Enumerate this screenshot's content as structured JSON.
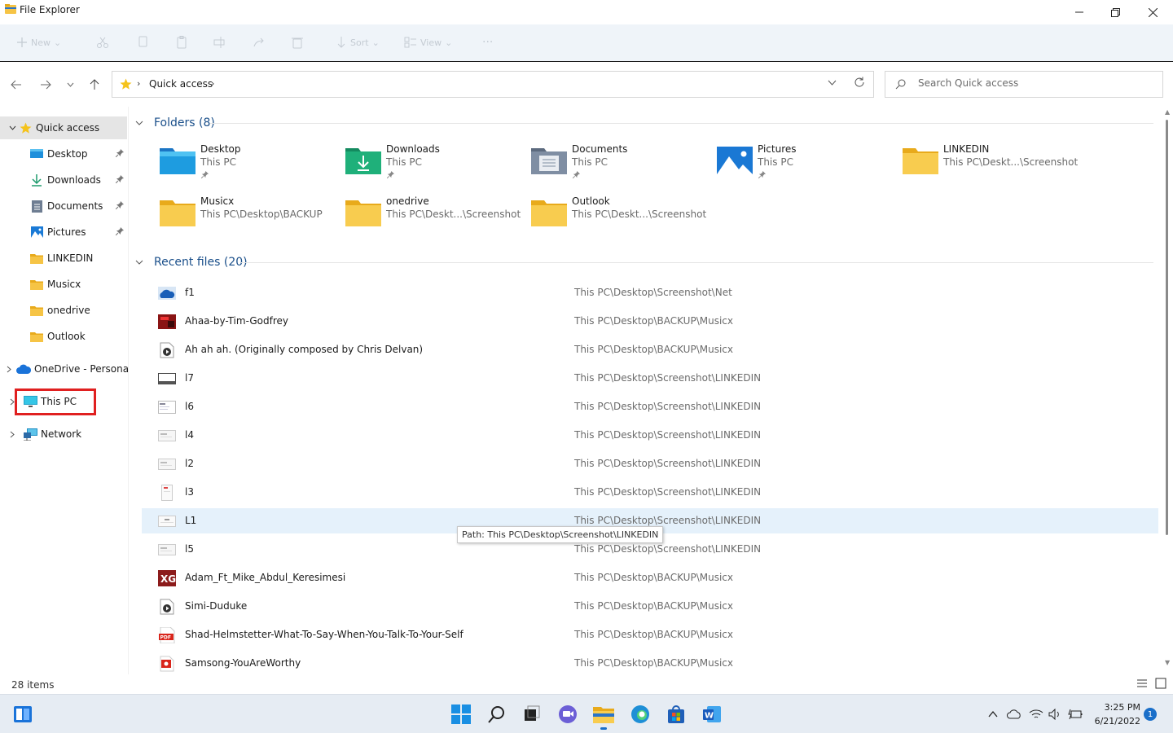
{
  "window": {
    "title": "File Explorer"
  },
  "toolbar": {
    "new_label": "New",
    "sort_label": "Sort",
    "view_label": "View",
    "more_label": "···"
  },
  "address": {
    "breadcrumb": "Quick access"
  },
  "search": {
    "placeholder": "Search Quick access"
  },
  "sidebar": {
    "items": [
      {
        "label": "Quick access",
        "icon": "star-icon"
      },
      {
        "label": "Desktop",
        "icon": "desktop-icon"
      },
      {
        "label": "Downloads",
        "icon": "download-icon"
      },
      {
        "label": "Documents",
        "icon": "document-icon"
      },
      {
        "label": "Pictures",
        "icon": "pictures-icon"
      },
      {
        "label": "LINKEDIN",
        "icon": "folder-icon"
      },
      {
        "label": "Musicx",
        "icon": "folder-icon"
      },
      {
        "label": "onedrive",
        "icon": "folder-icon"
      },
      {
        "label": "Outlook",
        "icon": "folder-icon"
      },
      {
        "label": "OneDrive - Personal",
        "icon": "cloud-icon"
      },
      {
        "label": "This PC",
        "icon": "monitor-icon"
      },
      {
        "label": "Network",
        "icon": "network-icon"
      }
    ]
  },
  "folders": {
    "header": "Folders (8)",
    "items": [
      {
        "name": "Desktop",
        "location": "This PC"
      },
      {
        "name": "Downloads",
        "location": "This PC"
      },
      {
        "name": "Documents",
        "location": "This PC"
      },
      {
        "name": "Pictures",
        "location": "This PC"
      },
      {
        "name": "LINKEDIN",
        "location": "This PC\\Deskt...\\Screenshot"
      },
      {
        "name": "Musicx",
        "location": "This PC\\Desktop\\BACKUP"
      },
      {
        "name": "onedrive",
        "location": "This PC\\Deskt...\\Screenshot"
      },
      {
        "name": "Outlook",
        "location": "This PC\\Deskt...\\Screenshot"
      }
    ]
  },
  "recent": {
    "header": "Recent files (20)",
    "items": [
      {
        "name": "f1",
        "path": "This PC\\Desktop\\Screenshot\\Net"
      },
      {
        "name": "Ahaa-by-Tim-Godfrey",
        "path": "This PC\\Desktop\\BACKUP\\Musicx"
      },
      {
        "name": "Ah ah ah. (Originally composed by Chris Delvan)",
        "path": "This PC\\Desktop\\BACKUP\\Musicx"
      },
      {
        "name": "l7",
        "path": "This PC\\Desktop\\Screenshot\\LINKEDIN"
      },
      {
        "name": "l6",
        "path": "This PC\\Desktop\\Screenshot\\LINKEDIN"
      },
      {
        "name": "l4",
        "path": "This PC\\Desktop\\Screenshot\\LINKEDIN"
      },
      {
        "name": "l2",
        "path": "This PC\\Desktop\\Screenshot\\LINKEDIN"
      },
      {
        "name": "l3",
        "path": "This PC\\Desktop\\Screenshot\\LINKEDIN"
      },
      {
        "name": "L1",
        "path": "This PC\\Desktop\\Screenshot\\LINKEDIN"
      },
      {
        "name": "l5",
        "path": "This PC\\Desktop\\Screenshot\\LINKEDIN"
      },
      {
        "name": "Adam_Ft_Mike_Abdul_Keresimesi",
        "path": "This PC\\Desktop\\BACKUP\\Musicx"
      },
      {
        "name": "Simi-Duduke",
        "path": "This PC\\Desktop\\BACKUP\\Musicx"
      },
      {
        "name": "Shad-Helmstetter-What-To-Say-When-You-Talk-To-Your-Self",
        "path": "This PC\\Desktop\\BACKUP\\Musicx"
      },
      {
        "name": "Samsong-YouAreWorthy",
        "path": "This PC\\Desktop\\BACKUP\\Musicx"
      }
    ]
  },
  "tooltip": {
    "text": "Path: This PC\\Desktop\\Screenshot\\LINKEDIN"
  },
  "status": {
    "item_count": "28 items"
  },
  "taskbar": {
    "time": "3:25 PM",
    "date": "6/21/2022",
    "notification_count": "1"
  },
  "colors": {
    "accent": "#1a6fc9",
    "folder_yellow": "#f6c445",
    "highlight_red": "#e02020",
    "hover_row": "#e5f1fb"
  }
}
